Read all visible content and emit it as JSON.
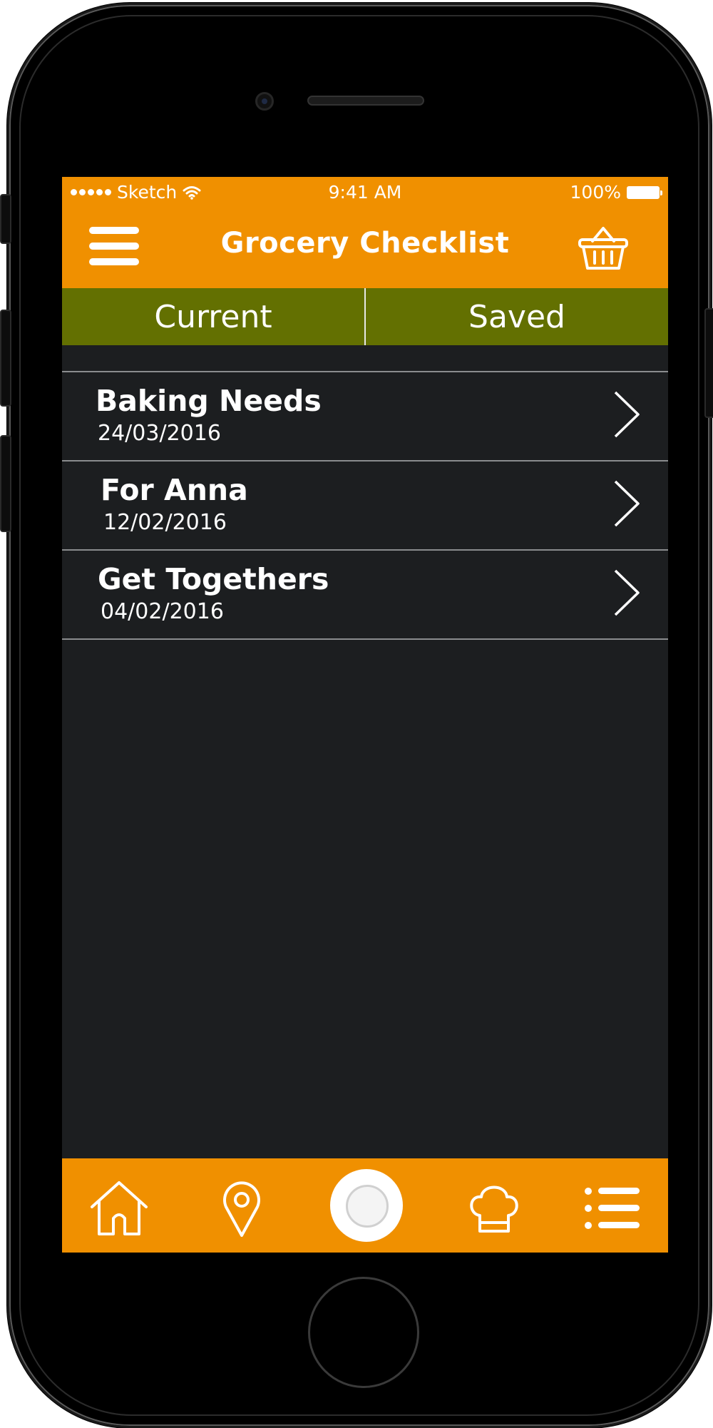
{
  "status_bar": {
    "carrier": "Sketch",
    "time": "9:41 AM",
    "battery": "100%"
  },
  "header": {
    "title": "Grocery Checklist",
    "menu_icon": "hamburger-menu-icon",
    "basket_icon": "basket-icon"
  },
  "tabs": [
    {
      "label": "Current"
    },
    {
      "label": "Saved"
    }
  ],
  "lists": [
    {
      "title": "Baking Needs",
      "date": "24/03/2016"
    },
    {
      "title": "For Anna",
      "date": "12/02/2016"
    },
    {
      "title": "Get Togethers",
      "date": "04/02/2016"
    }
  ],
  "tab_bar": {
    "icons": [
      "home-icon",
      "location-pin-icon",
      "camera-shutter-icon",
      "chef-hat-icon",
      "list-icon"
    ]
  },
  "colors": {
    "accent_orange": "#f09000",
    "segment_green": "#637001",
    "background_dark": "#1c1e20"
  }
}
